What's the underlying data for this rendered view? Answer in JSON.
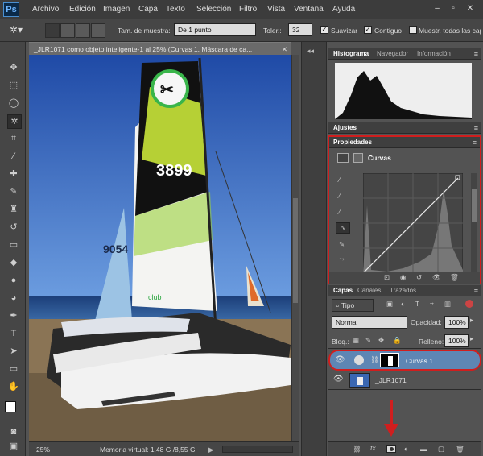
{
  "app": {
    "logo": "Ps"
  },
  "menu": [
    "Archivo",
    "Edición",
    "Imagen",
    "Capa",
    "Texto",
    "Selección",
    "Filtro",
    "Vista",
    "Ventana",
    "Ayuda"
  ],
  "options": {
    "sample_size_label": "Tam. de muestra:",
    "sample_size_value": "De 1 punto",
    "tolerance_label": "Toler.:",
    "tolerance_value": "32",
    "antialias_label": "Suavizar",
    "contiguous_label": "Contiguo",
    "sample_all_label": "Muestr. todas las capas"
  },
  "document": {
    "tab_title": "_JLR1071 como objeto inteligente-1 al 25% (Curvas 1, Máscara de ca...",
    "zoom": "25%",
    "memory": "Memoria virtual: 1,48 G /8,55 G",
    "sail_number": "9054",
    "brand": "club"
  },
  "panels": {
    "histogram_tabs": [
      "Histograma",
      "Navegador",
      "Información"
    ],
    "adjustments_label": "Ajustes",
    "properties_label": "Propiedades",
    "curves_label": "Curvas",
    "layers_tabs": [
      "Capas",
      "Canales",
      "Trazados"
    ],
    "filter_kind": "Tipo",
    "blend_mode": "Normal",
    "opacity_label": "Opacidad:",
    "opacity_value": "100%",
    "lock_label": "Bloq.:",
    "fill_label": "Relleno:",
    "fill_value": "100%",
    "layers": [
      {
        "name": "Curvas 1",
        "selected": true
      },
      {
        "name": "_JLR1071",
        "selected": false
      }
    ]
  },
  "colors": {
    "highlight": "#d01e1e",
    "selected_layer": "#5e86b4"
  },
  "icons": [
    "magic-wand-icon",
    "eye-icon",
    "add-mask-icon",
    "fx-icon",
    "trash-icon",
    "link-icon"
  ]
}
